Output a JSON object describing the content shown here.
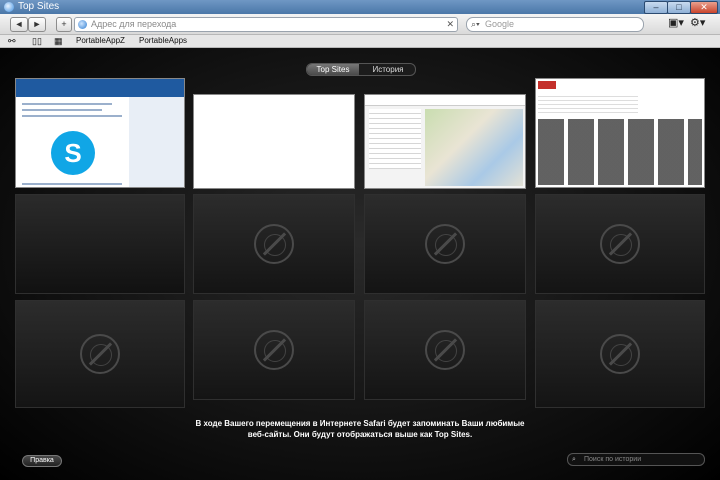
{
  "window": {
    "title": "Top Sites",
    "controls": [
      "–",
      "□",
      "✕"
    ]
  },
  "toolbar": {
    "back": "◄",
    "forward": "►",
    "add": "+",
    "address_placeholder": "Адрес для перехода",
    "address_clear": "✕",
    "search_placeholder": "Google",
    "page_menu": "▣▾",
    "settings_menu": "⚙▾"
  },
  "bookmarks": {
    "reader_icon": "glasses-icon",
    "book_icon": "book-icon",
    "grid_icon": "grid-icon",
    "items": [
      "PortableAppZ",
      "PortableApps"
    ]
  },
  "topsites": {
    "tabs": [
      "Top Sites",
      "История"
    ],
    "active_tab": "Top Sites",
    "thumbnails": [
      "skype-site-thumbnail",
      "blank-page-thumbnail",
      "google-maps-thumbnail",
      "youtube-thumbnail"
    ],
    "message_line1": "В ходе Вашего перемещения в Интернете Safari будет запоминать Ваши любимые",
    "message_line2": "веб-сайты. Они будут отображаться выше как Top Sites.",
    "edit_button": "Правка",
    "history_search_placeholder": "Поиск по истории"
  },
  "colors": {
    "titlebar": "#4a77a8",
    "content_bg": "#111111",
    "accent_blue": "#10a6e6"
  }
}
